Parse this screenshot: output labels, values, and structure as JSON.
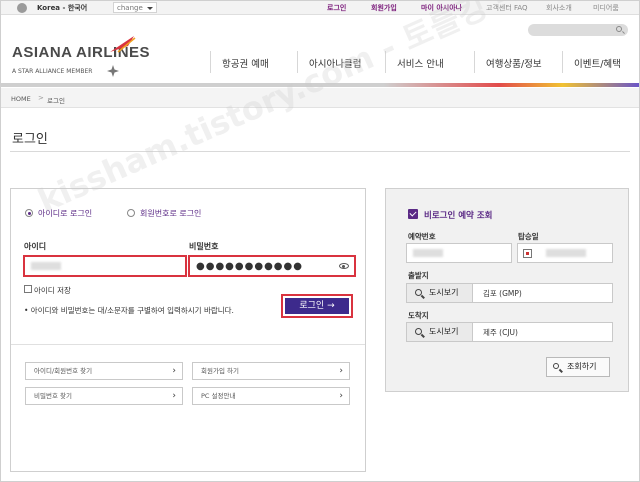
{
  "topbar": {
    "country": "Korea - 한국어",
    "change_label": "change",
    "links": [
      "로그인",
      "회원가입",
      "마이 아시아나",
      "고객센터 FAQ",
      "회사소개",
      "미디어룸"
    ]
  },
  "header": {
    "logo_text": "ASIANA AIRLINES",
    "logo_sub": "A STAR ALLIANCE MEMBER",
    "nav": [
      "항공권 예매",
      "아시아나클럽",
      "서비스 안내",
      "여행상품/정보",
      "이벤트/혜택"
    ]
  },
  "breadcrumb": {
    "home": "HOME",
    "sep": ">",
    "current": "로그인"
  },
  "page_title": "로그인",
  "watermark": "kissham.tistory.com - 토를킹 -",
  "login": {
    "tab_id": "아이디로 로그인",
    "tab_member_no": "회원번호로 로그인",
    "id_label": "아이디",
    "pw_label": "비밀번호",
    "pw_value": "●●●●●●●●●●●",
    "save_id_label": "아이디 저장",
    "notice": "• 아이디와 비밀번호는 대/소문자를 구별하여 입력하시기 바랍니다.",
    "login_button": "로그인 →",
    "links": [
      "아이디/회원번호 찾기",
      "회원가입 하기",
      "비밀번호 찾기",
      "PC 설정안내"
    ]
  },
  "reservation": {
    "title": "비로그인 예약 조회",
    "booking_no_label": "예약번호",
    "boarding_date_label": "탑승일",
    "departure_label": "출발지",
    "arrival_label": "도착지",
    "airport_button": "도시보기",
    "departure_value": "김포 (GMP)",
    "arrival_value": "제주 (CJU)",
    "lookup_button": "조회하기"
  },
  "colors": {
    "accent": "#5b2a86",
    "highlight": "#d9333f",
    "button": "#3d2a8c"
  }
}
